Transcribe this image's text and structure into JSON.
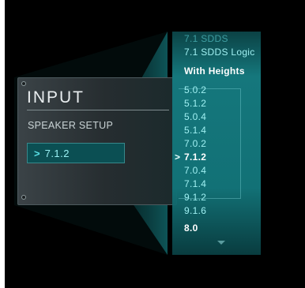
{
  "input_panel": {
    "title": "INPUT",
    "subtitle": "SPEAKER SETUP",
    "selected_value": "7.1.2"
  },
  "dropdown": {
    "items": [
      {
        "label": "7.1 SDDS",
        "style": "faded"
      },
      {
        "label": "7.1 SDDS Logic",
        "style": "normal"
      },
      {
        "label": "With Heights",
        "style": "header"
      },
      {
        "label": "5.0.2",
        "style": "normal"
      },
      {
        "label": "5.1.2",
        "style": "normal"
      },
      {
        "label": "5.0.4",
        "style": "normal"
      },
      {
        "label": "5.1.4",
        "style": "normal"
      },
      {
        "label": "7.0.2",
        "style": "normal"
      },
      {
        "label": "7.1.2",
        "style": "selected"
      },
      {
        "label": "7.0.4",
        "style": "normal"
      },
      {
        "label": "7.1.4",
        "style": "normal"
      },
      {
        "label": "9.1.2",
        "style": "normal"
      },
      {
        "label": "9.1.6",
        "style": "normal"
      },
      {
        "label": "8.0",
        "style": "bold"
      }
    ]
  },
  "colors": {
    "accent": "#127176",
    "item_text": "#9ff0f2",
    "selected_text": "#ffffff",
    "panel_value_bg": "#0b4f53"
  },
  "icons": {
    "selected_marker": "chevron-right-icon",
    "scroll_indicator": "chevron-down-icon"
  }
}
